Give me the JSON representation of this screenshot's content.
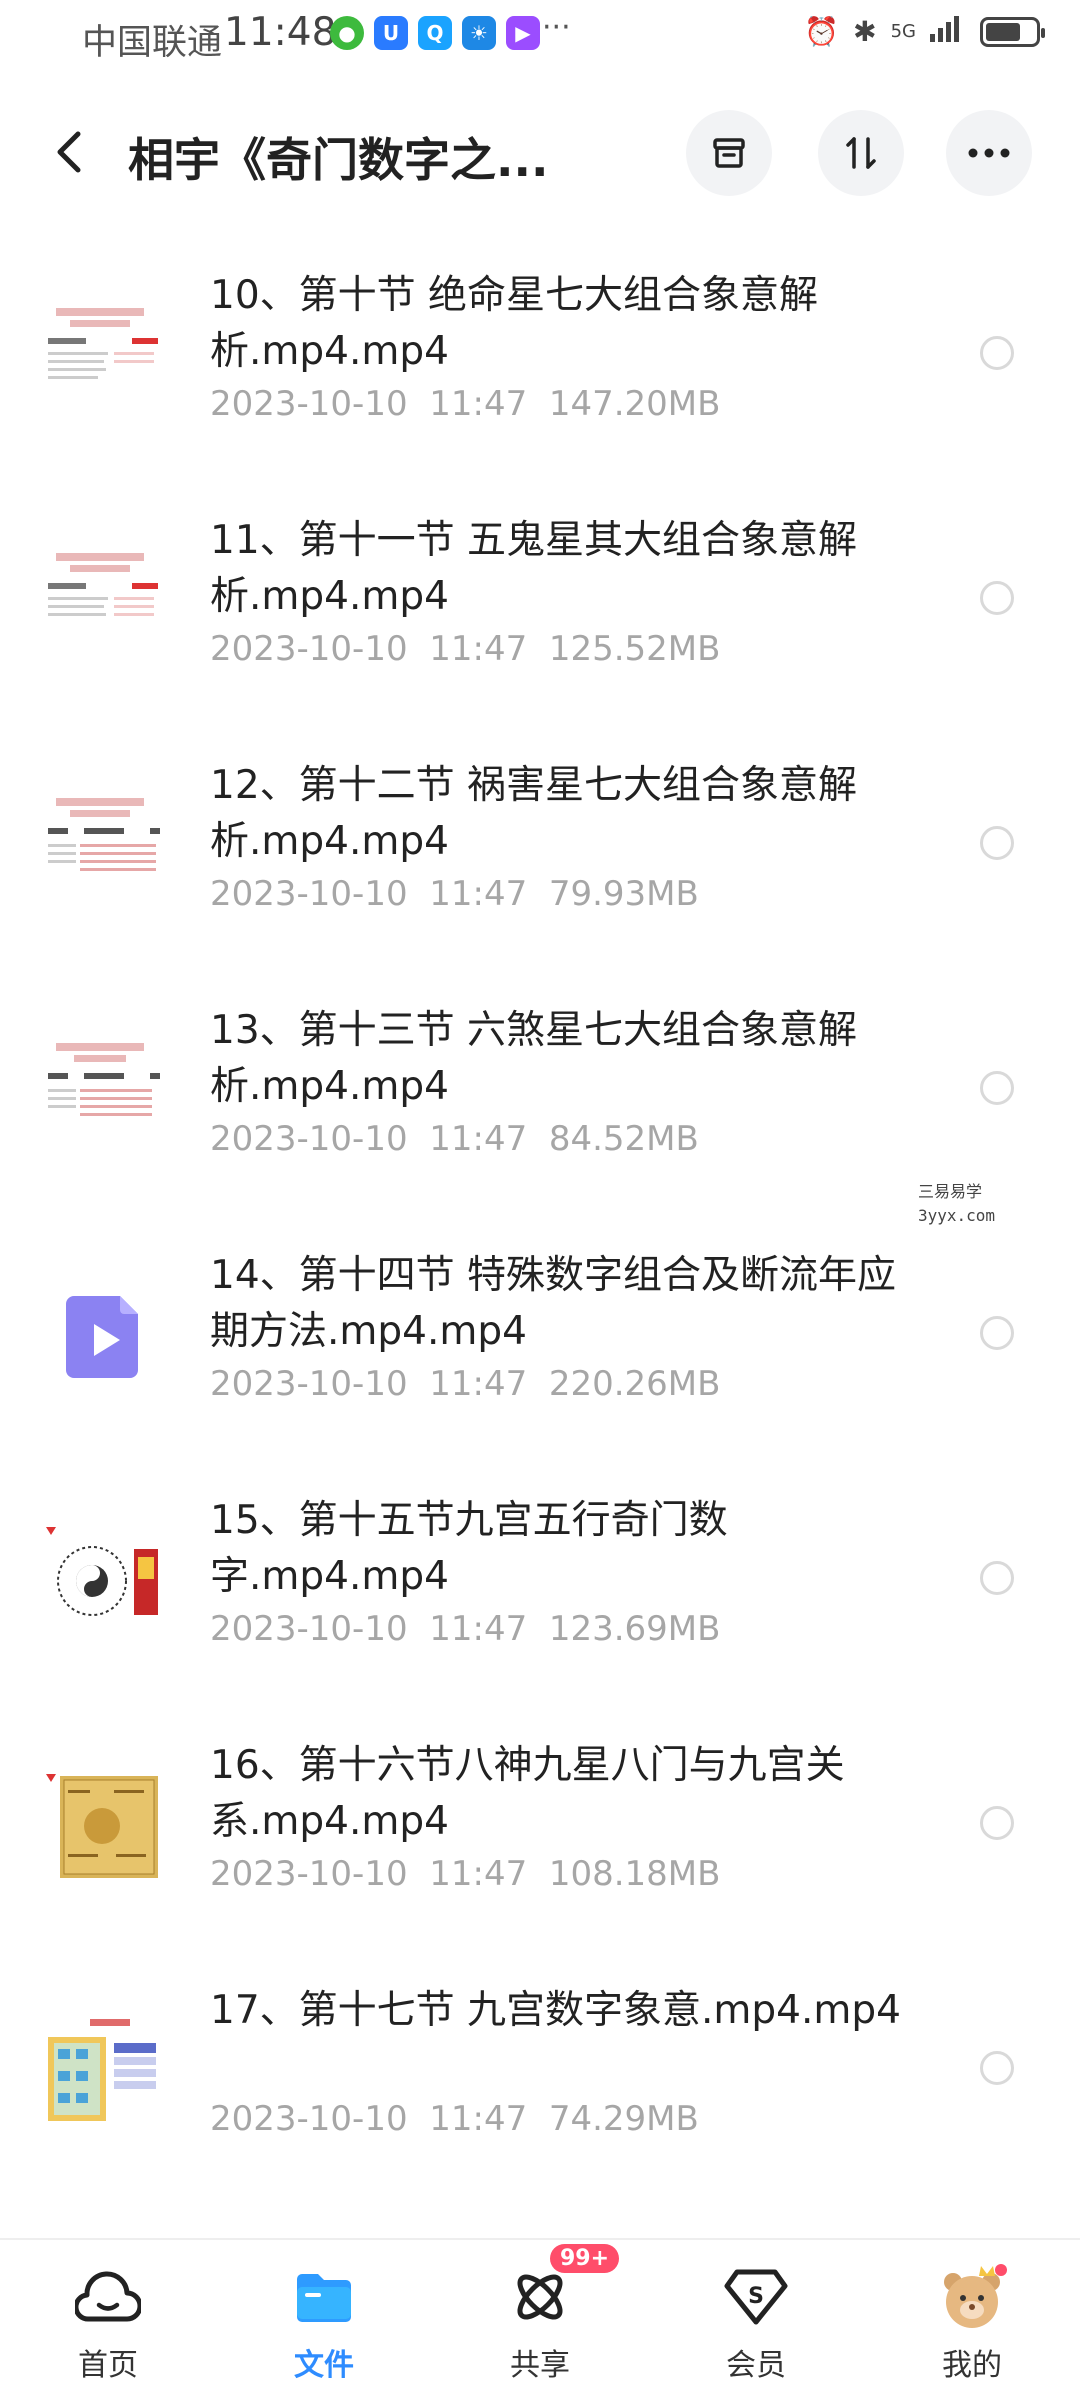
{
  "status": {
    "carrier": "中国联通",
    "time": "11:48",
    "dots": "···",
    "network": "5G"
  },
  "header": {
    "title": "相宇《奇门数字之..."
  },
  "files": [
    {
      "title": "10、第十节 绝命星七大组合象意解析.mp4.mp4",
      "date": "2023-10-10",
      "time": "11:47",
      "size": "147.20MB",
      "thumb": "doc"
    },
    {
      "title": "11、第十一节 五鬼星其大组合象意解析.mp4.mp4",
      "date": "2023-10-10",
      "time": "11:47",
      "size": "125.52MB",
      "thumb": "doc"
    },
    {
      "title": "12、第十二节 祸害星七大组合象意解析.mp4.mp4",
      "date": "2023-10-10",
      "time": "11:47",
      "size": "79.93MB",
      "thumb": "doc"
    },
    {
      "title": "13、第十三节 六煞星七大组合象意解析.mp4.mp4",
      "date": "2023-10-10",
      "time": "11:47",
      "size": "84.52MB",
      "thumb": "doc"
    },
    {
      "title": "14、第十四节 特殊数字组合及断流年应期方法.mp4.mp4",
      "date": "2023-10-10",
      "time": "11:47",
      "size": "220.26MB",
      "thumb": "video"
    },
    {
      "title": "15、第十五节九宫五行奇门数字.mp4.mp4",
      "date": "2023-10-10",
      "time": "11:47",
      "size": "123.69MB",
      "thumb": "bagua"
    },
    {
      "title": "16、第十六节八神九星八门与九宫关系.mp4.mp4",
      "date": "2023-10-10",
      "time": "11:47",
      "size": "108.18MB",
      "thumb": "gold"
    },
    {
      "title": "17、第十七节 九宫数字象意.mp4.mp4",
      "date": "2023-10-10",
      "time": "11:47",
      "size": "74.29MB",
      "thumb": "grid"
    }
  ],
  "watermark": {
    "line1": "三易易学",
    "line2": "3yyx.com"
  },
  "nav": [
    {
      "label": "首页",
      "icon": "home-cloud-icon"
    },
    {
      "label": "文件",
      "icon": "folder-icon"
    },
    {
      "label": "共享",
      "icon": "share-orbit-icon",
      "badge": "99+"
    },
    {
      "label": "会员",
      "icon": "vip-diamond-icon"
    },
    {
      "label": "我的",
      "icon": "avatar-bear-icon"
    }
  ],
  "colors": {
    "accent": "#2e8cff",
    "badge": "#ff4d6a",
    "meta_text": "#a6a6a6"
  }
}
